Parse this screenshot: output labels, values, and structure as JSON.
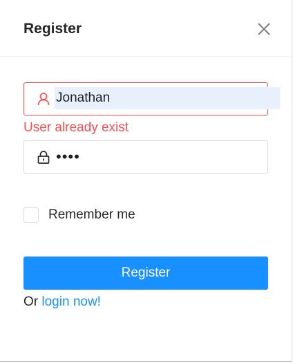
{
  "dialog": {
    "title": "Register"
  },
  "form": {
    "username": {
      "value": "Jonathan",
      "error": "User already exist",
      "icon": "user-icon"
    },
    "password": {
      "value": "••••",
      "icon": "lock-icon"
    },
    "remember": {
      "label": "Remember me",
      "checked": false
    },
    "submit_label": "Register",
    "footer": {
      "prefix": "Or",
      "link_label": "login now!"
    }
  },
  "colors": {
    "primary": "#1890ff",
    "error": "#ff4d4f",
    "autofill": "#e8f0fe"
  }
}
